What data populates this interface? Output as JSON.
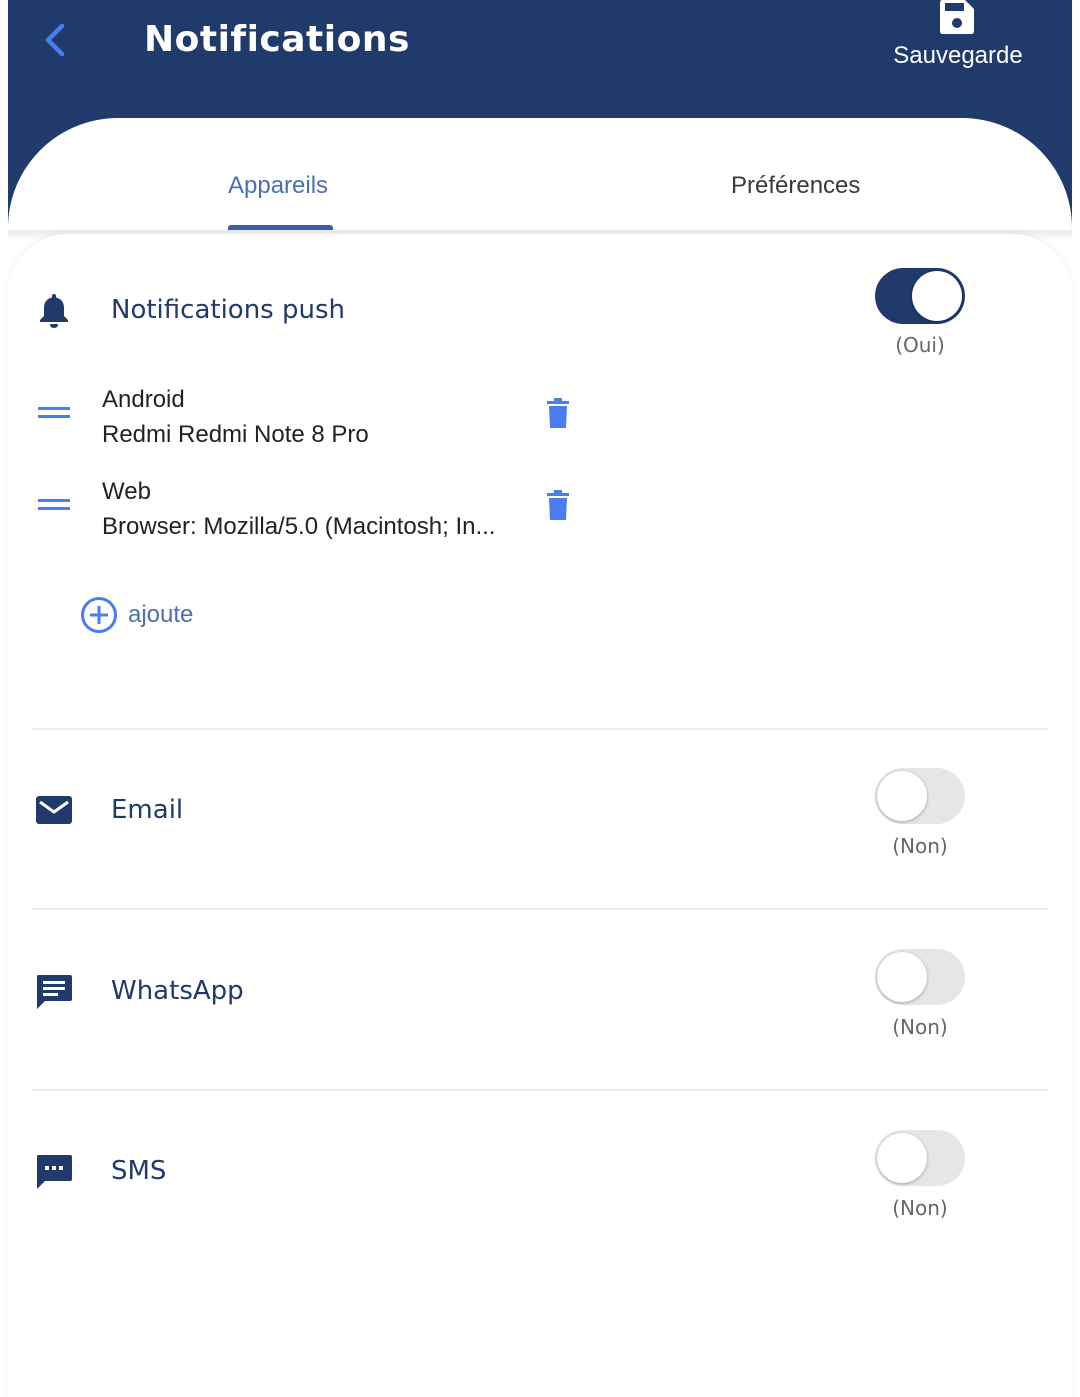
{
  "header": {
    "title": "Notifications",
    "save_label": "Sauvegarde"
  },
  "tabs": [
    {
      "label": "Appareils",
      "active": true
    },
    {
      "label": "Préférences",
      "active": false
    }
  ],
  "channels": {
    "push": {
      "title": "Notifications push",
      "enabled": true,
      "state_label": "(Oui)",
      "devices": [
        {
          "type": "Android",
          "name": "Redmi Redmi Note 8 Pro"
        },
        {
          "type": "Web",
          "name": "Browser: Mozilla/5.0 (Macintosh; In..."
        }
      ],
      "add_label": "ajoute"
    },
    "email": {
      "title": "Email",
      "enabled": false,
      "state_label": "(Non)"
    },
    "whatsapp": {
      "title": "WhatsApp",
      "enabled": false,
      "state_label": "(Non)"
    },
    "sms": {
      "title": "SMS",
      "enabled": false,
      "state_label": "(Non)"
    }
  },
  "icons": {
    "back": "chevron-left-icon",
    "save": "floppy-disk-icon",
    "push": "bell-icon",
    "email": "envelope-icon",
    "whatsapp": "message-text-icon",
    "sms": "sms-dots-icon",
    "drag": "drag-handle-icon",
    "delete": "trash-icon",
    "add": "plus-circle-icon"
  },
  "colors": {
    "primary": "#1f3a6b",
    "accent": "#4a6fb5",
    "trash": "#4a7df0",
    "toggle_off": "#e6e6e6"
  }
}
